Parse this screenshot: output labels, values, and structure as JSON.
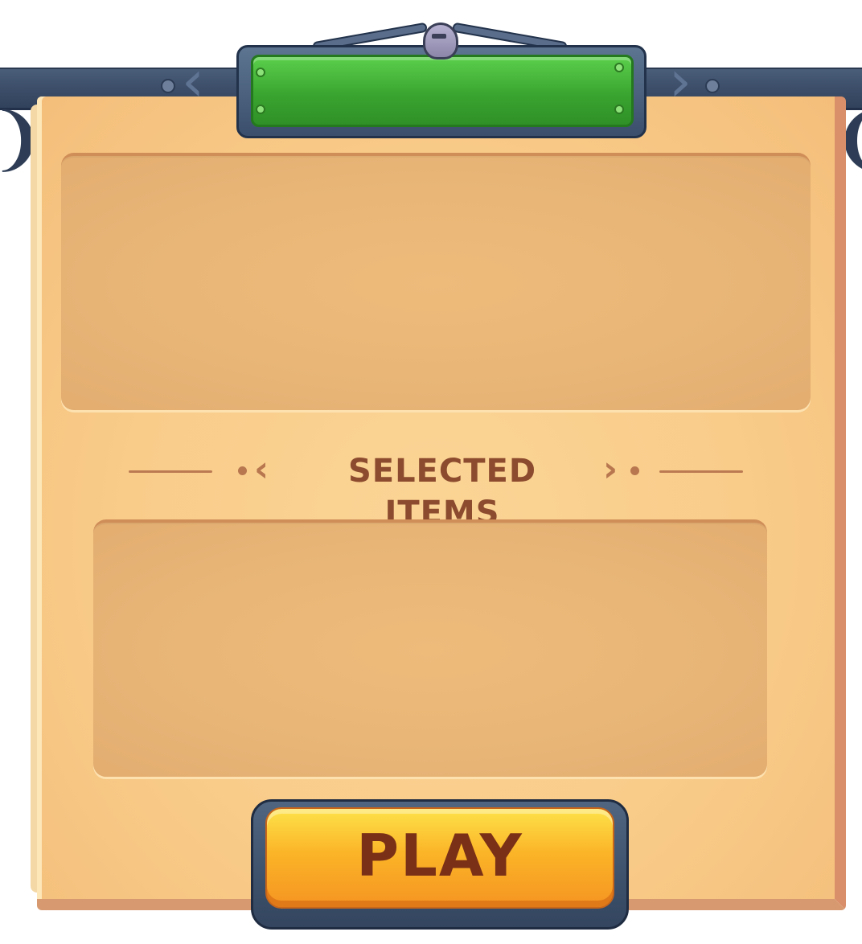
{
  "selected_items": {
    "title": "SELECTED ITEMS"
  },
  "play_button": {
    "label": "PLAY"
  },
  "banner": {
    "label": ""
  },
  "colors": {
    "parchment": "#f9cc8a",
    "panel": "#e8b577",
    "title_text": "#8c4b2e",
    "banner_green": "#3aa530",
    "rail": "#3d4f6a",
    "play_orange": "#fbb427",
    "play_text": "#7a3016"
  },
  "icons": [
    "helmet-icon",
    "left-arrow-icon",
    "right-arrow-icon",
    "hook-icon"
  ]
}
